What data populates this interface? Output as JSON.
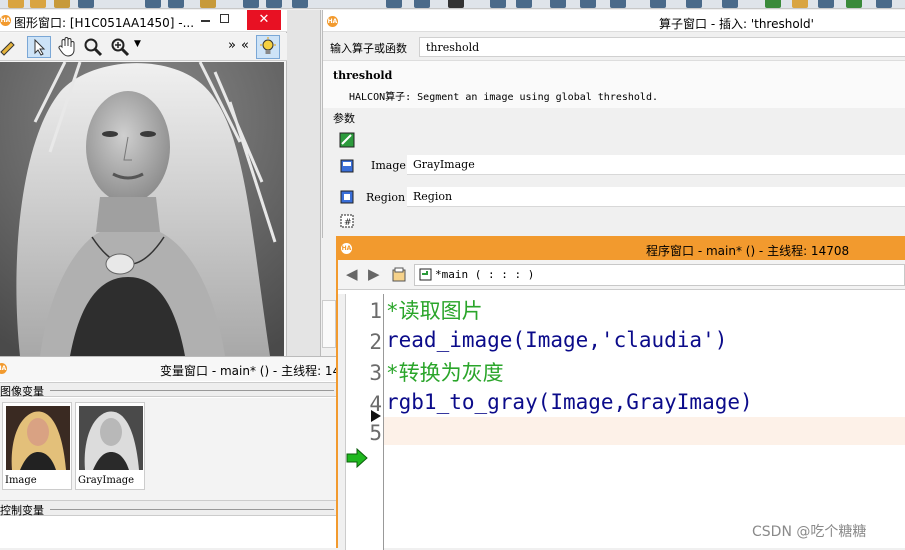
{
  "graphics_window": {
    "title": "图形窗口: [H1C051AA1450] -...",
    "overflow": "»",
    "collapse": "«"
  },
  "variable_window": {
    "title": "变量窗口 - main* () - 主线程: 14",
    "image_vars_label": "图像变量",
    "control_vars_label": "控制变量",
    "thumbnails": [
      {
        "label": "Image"
      },
      {
        "label": "GrayImage"
      }
    ]
  },
  "operator_window": {
    "title": "算子窗口 - 插入: 'threshold'",
    "input_label": "输入算子或函数",
    "input_value": "threshold",
    "op_name": "threshold",
    "op_desc": "HALCON算子: Segment an image using global threshold.",
    "params_label": "参数",
    "params": [
      {
        "name": "Image",
        "value": "GrayImage"
      },
      {
        "name": "Region",
        "value": "Region"
      }
    ]
  },
  "program_window": {
    "title": "程序窗口 - main* () - 主线程: 14708",
    "procedure": "*main ( : : : )",
    "lines": [
      {
        "num": "1",
        "text": "*读取图片",
        "kind": "comment"
      },
      {
        "num": "2",
        "text": "read_image(Image,'claudia')",
        "kind": "code"
      },
      {
        "num": "3",
        "text": "*转换为灰度",
        "kind": "comment"
      },
      {
        "num": "4",
        "text": "rgb1_to_gray(Image,GrayImage)",
        "kind": "code"
      },
      {
        "num": "5",
        "text": "",
        "kind": "empty"
      }
    ]
  },
  "watermark": "CSDN @吃个糖糖",
  "colors": {
    "accent": "#f29a2e",
    "comment": "#2aa52a",
    "code": "#0b0b8a",
    "line_highlight": "#fdf1e8"
  }
}
